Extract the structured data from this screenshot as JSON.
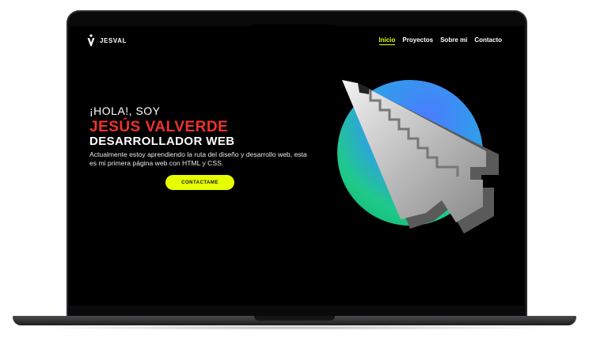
{
  "site": {
    "brand": "JESVAL"
  },
  "nav": {
    "items": [
      {
        "label": "Inicio",
        "active": true
      },
      {
        "label": "Proyectos",
        "active": false
      },
      {
        "label": "Sobre mi",
        "active": false
      },
      {
        "label": "Contacto",
        "active": false
      }
    ]
  },
  "hero": {
    "greeting": "¡HOLA!, SOY",
    "name": "JESÚS VALVERDE",
    "role": "DESARROLLADOR WEB",
    "description": "Actualmente estoy aprendiendo la ruta del diseño y desarrollo web, esta es mi primera página web con HTML y CSS.",
    "cta_label": "CONTACTAME"
  },
  "colors": {
    "accent": "#e6ff00",
    "name_red": "#f0312e",
    "background": "#000000"
  },
  "icons": {
    "logo": "v-logo-icon",
    "hero_art": "pixel-cursor-icon"
  }
}
